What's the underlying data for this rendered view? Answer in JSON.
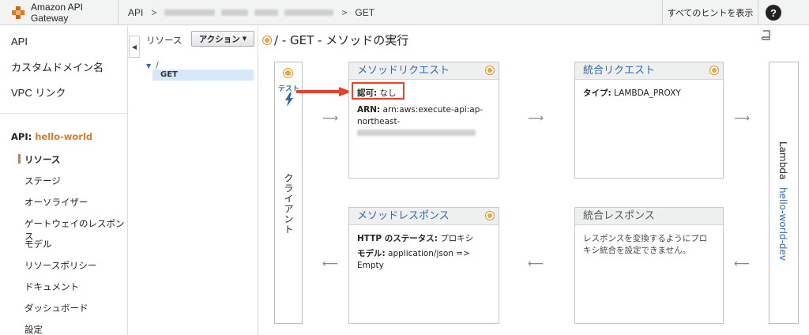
{
  "topbar": {
    "logo_text": "Amazon API Gateway",
    "crumb_api": "API",
    "crumb_sep": ">",
    "crumb_get": "GET",
    "hints": "すべてのヒントを表示",
    "help": "?"
  },
  "leftnav": {
    "top_items": [
      "API",
      "カスタムドメイン名",
      "VPC リンク"
    ],
    "api_label": "API:",
    "api_name": "hello-world",
    "sub_items": [
      "リソース",
      "ステージ",
      "オーソライザー",
      "ゲートウェイのレスポンス",
      "モデル",
      "リソースポリシー",
      "ドキュメント",
      "ダッシュボード",
      "設定"
    ]
  },
  "resources": {
    "label": "リソース",
    "action_button": "アクション",
    "root": "/",
    "method": "GET"
  },
  "main": {
    "title": "/ - GET - メソッドの実行",
    "client": {
      "test_label": "テスト",
      "label": "クライアント"
    },
    "method_request": {
      "title": "メソッドリクエスト",
      "auth_label": "認可:",
      "auth_value": "なし",
      "arn_label": "ARN:",
      "arn_value": "arn:aws:execute-api:ap-northeast-"
    },
    "integration_request": {
      "title": "統合リクエスト",
      "type_label": "タイプ:",
      "type_value": "LAMBDA_PROXY"
    },
    "method_response": {
      "title": "メソッドレスポンス",
      "status_label": "HTTP のステータス:",
      "status_value": "プロキシ",
      "model_label": "モデル:",
      "model_value": "application/json => Empty"
    },
    "integration_response": {
      "title": "統合レスポンス",
      "text": "レスポンスを変換するようにプロキシ統合を設定できません。"
    },
    "lambda": {
      "label": "Lambda",
      "function": "hello-world-dev"
    }
  },
  "colors": {
    "accent_orange": "#e07b24",
    "link_blue": "#2d6ab0",
    "highlight_red": "#e8412a"
  }
}
